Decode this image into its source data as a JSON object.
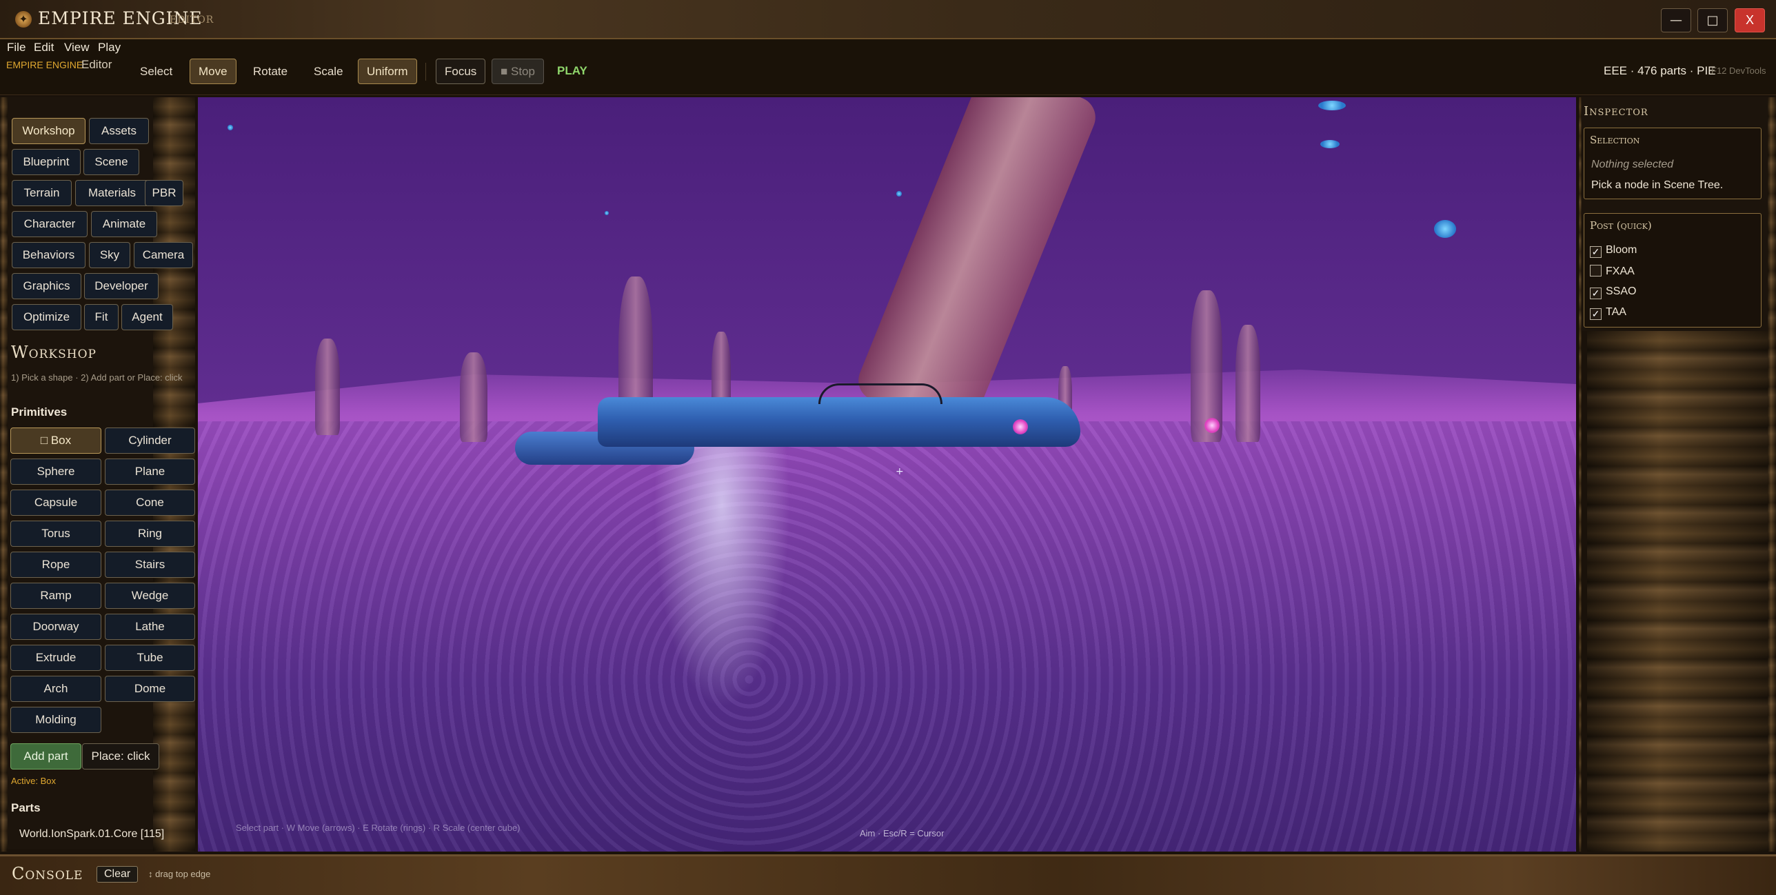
{
  "window": {
    "title": "EMPIRE ENGINE",
    "subtitle": "EDITOR",
    "minimize": "—",
    "maximize": "□",
    "close": "X"
  },
  "menu": [
    "File",
    "Edit",
    "View",
    "Play"
  ],
  "toolbar": {
    "brand": "EMPIRE ENGINE",
    "mode": "Editor",
    "select": "Select",
    "move": "Move",
    "rotate": "Rotate",
    "scale": "Scale",
    "uniform": "Uniform",
    "focus": "Focus",
    "stop": "■ Stop",
    "play": "PLAY",
    "status": "EEE · 476 parts · PIE",
    "devtools_hint": "F12 DevTools"
  },
  "left_panel": {
    "tabs": [
      "Workshop",
      "Assets",
      "Blueprint",
      "Scene",
      "Terrain",
      "Materials",
      "PBR",
      "Character",
      "Animate",
      "Behaviors",
      "Sky",
      "Camera",
      "Graphics",
      "Developer",
      "Optimize",
      "Fit",
      "Agent"
    ],
    "active_tab": "Workshop",
    "section_title": "Workshop",
    "hint": "1) Pick a shape · 2) Add part or Place: click",
    "primitives_title": "Primitives",
    "primitives": [
      "□ Box",
      "Cylinder",
      "Sphere",
      "Plane",
      "Capsule",
      "Cone",
      "Torus",
      "Ring",
      "Rope",
      "Stairs",
      "Ramp",
      "Wedge",
      "Doorway",
      "Lathe",
      "Extrude",
      "Tube",
      "Arch",
      "Dome",
      "Molding"
    ],
    "add_part": "Add part",
    "place_click": "Place: click",
    "active_label": "Active: Box",
    "parts_title": "Parts",
    "parts": [
      "World.IonSpark.01.Core  [115]"
    ]
  },
  "viewport": {
    "hint_left": "Select part · W Move (arrows) · E Rotate (rings) · R Scale (center cube)",
    "hint_center": "Aim · Esc/R = Cursor",
    "crosshair": "+"
  },
  "inspector": {
    "title": "Inspector",
    "selection_title": "Selection",
    "nothing_selected": "Nothing selected",
    "pick_hint": "Pick a node in Scene Tree.",
    "post_title": "Post (quick)",
    "post_options": [
      {
        "label": "Bloom",
        "checked": true
      },
      {
        "label": "FXAA",
        "checked": false
      },
      {
        "label": "SSAO",
        "checked": true
      },
      {
        "label": "TAA",
        "checked": true
      }
    ]
  },
  "console": {
    "title": "Console",
    "clear": "Clear",
    "hint": "↕ drag top edge"
  }
}
